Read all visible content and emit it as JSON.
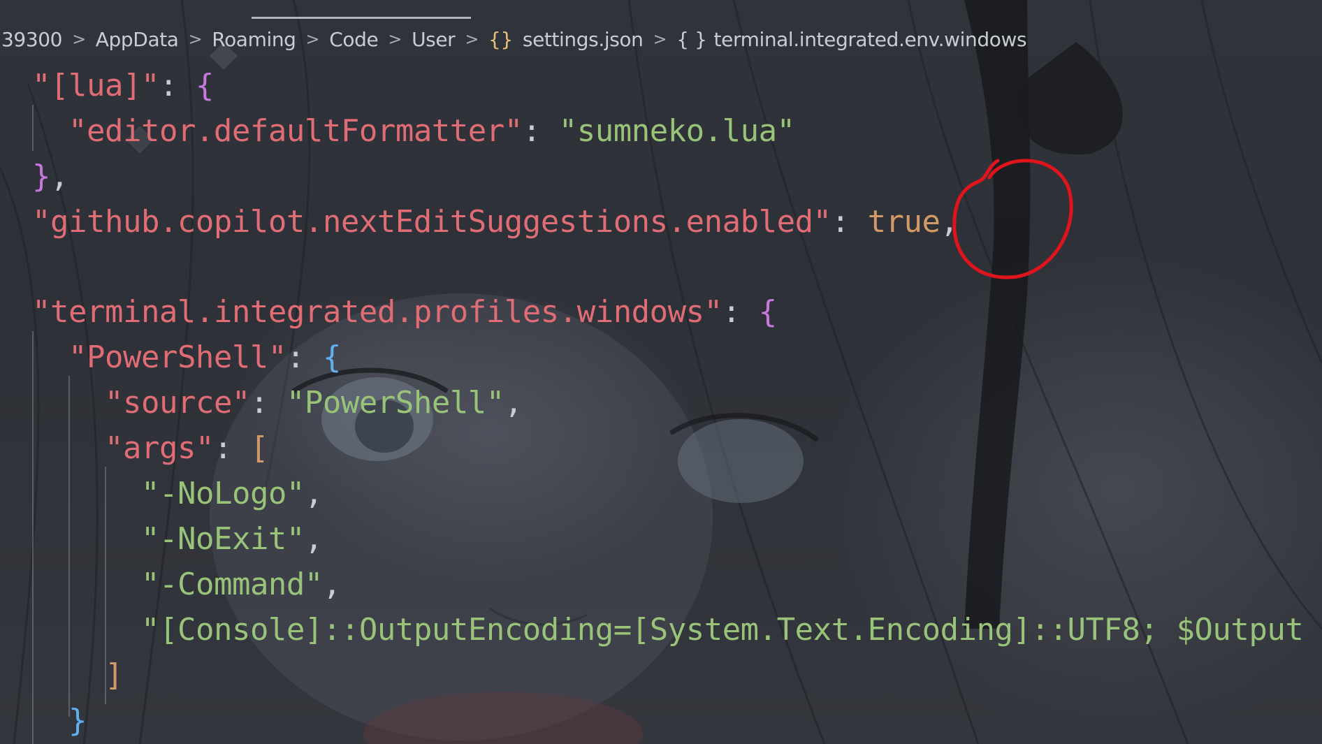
{
  "breadcrumb": {
    "items": [
      "39300",
      "AppData",
      "Roaming",
      "Code",
      "User"
    ],
    "file": "settings.json",
    "symbol": "terminal.integrated.env.windows",
    "json_icon": "{}",
    "object_icon": "{ }",
    "separator": ">"
  },
  "code": {
    "l1_key": "\"[lua]\"",
    "l1_colon": ": ",
    "l1_brace": "{",
    "l2_key": "\"editor.defaultFormatter\"",
    "l2_colon": ": ",
    "l2_value": "\"sumneko.lua\"",
    "l3_brace": "}",
    "l3_comma": ",",
    "l4_key": "\"github.copilot.nextEditSuggestions.enabled\"",
    "l4_colon": ": ",
    "l4_value": "true",
    "l4_comma": ",",
    "l6_key": "\"terminal.integrated.profiles.windows\"",
    "l6_colon": ": ",
    "l6_brace": "{",
    "l7_key": "\"PowerShell\"",
    "l7_colon": ": ",
    "l7_brace": "{",
    "l8_key": "\"source\"",
    "l8_colon": ": ",
    "l8_value": "\"PowerShell\"",
    "l8_comma": ",",
    "l9_key": "\"args\"",
    "l9_colon": ": ",
    "l9_bracket": "[",
    "l10_value": "\"-NoLogo\"",
    "l10_comma": ",",
    "l11_value": "\"-NoExit\"",
    "l11_comma": ",",
    "l12_value": "\"-Command\"",
    "l12_comma": ",",
    "l13_value": "\"[Console]::OutputEncoding=[System.Text.Encoding]::UTF8; $Output",
    "l14_bracket": "]",
    "l15_brace": "}"
  },
  "annotation": {
    "color": "#e0141c",
    "shape": "hand-drawn-circle"
  },
  "colors": {
    "key": "#e06c75",
    "string": "#98c379",
    "boolean": "#d19a66",
    "brace_level1": "#c678dd",
    "brace_level2": "#61afef",
    "bracket_level3": "#d19a66"
  }
}
